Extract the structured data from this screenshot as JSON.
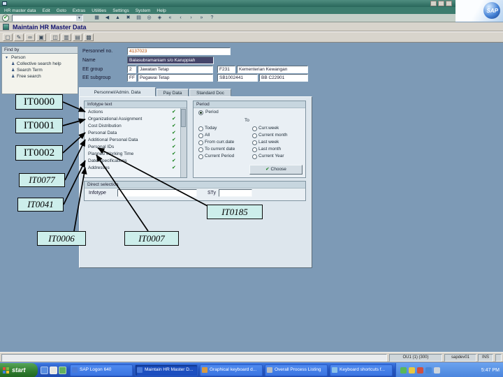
{
  "window": {
    "menu_items": [
      "HR master data",
      "Edit",
      "Goto",
      "Extras",
      "Utilities",
      "Settings",
      "System",
      "Help"
    ],
    "logo_text": "SAP",
    "screen_title": "Maintain HR Master Data"
  },
  "toolbar": {
    "command_value": "",
    "enter_glyph": "✔",
    "dropdown_glyph": "▼",
    "icons": [
      {
        "name": "save",
        "glyph": "▦"
      },
      {
        "name": "back",
        "glyph": "◀"
      },
      {
        "name": "exit",
        "glyph": "▲"
      },
      {
        "name": "cancel",
        "glyph": "✖"
      },
      {
        "name": "print",
        "glyph": "▤"
      },
      {
        "name": "find",
        "glyph": "◎"
      },
      {
        "name": "find-next",
        "glyph": "◈"
      },
      {
        "name": "first-page",
        "glyph": "«"
      },
      {
        "name": "page-up",
        "glyph": "‹"
      },
      {
        "name": "page-down",
        "glyph": "›"
      },
      {
        "name": "last-page",
        "glyph": "»"
      },
      {
        "name": "help",
        "glyph": "?"
      }
    ]
  },
  "app_toolbar": {
    "icons": [
      {
        "name": "create",
        "glyph": "▢"
      },
      {
        "name": "change",
        "glyph": "✎"
      },
      {
        "name": "display",
        "glyph": "∞"
      },
      {
        "name": "copy",
        "glyph": "▣"
      },
      {
        "name": "delimit",
        "glyph": "◫"
      },
      {
        "name": "delete",
        "glyph": "▥"
      },
      {
        "name": "overview",
        "glyph": "▤"
      },
      {
        "name": "measures",
        "glyph": "▩"
      }
    ]
  },
  "find_by": {
    "title": "Find by",
    "root_expander": "▾",
    "person_glyph": "♟",
    "root_label": "Person",
    "items": [
      "Collective search help",
      "Search Term",
      "Free search"
    ]
  },
  "form": {
    "personnel_no_label": "Personnel no.",
    "personnel_no_value": "4137023",
    "name_label": "Name",
    "name_value": "Balasubramaniam s/o Karuppiah",
    "ee_group_label": "EE group",
    "ee_group_value": "2",
    "ee_group_text": "Jawatan Tetap",
    "pers_area_value": "F231",
    "pers_area_text": "Kementerian Kewangan",
    "ee_subgroup_label": "EE subgroup",
    "ee_subgroup_value": "FF",
    "ee_subgroup_text": "Pegawai Tetap",
    "cost_center_value": "SB1002441",
    "cost_center_text": "BB C22901"
  },
  "tabs": {
    "items": [
      "Personnel/Admin. Data",
      "Pay Data",
      "Standard Doc"
    ]
  },
  "infotype_list": {
    "header": "Infotype text",
    "check_glyph": "✔",
    "rows": [
      "Actions",
      "Organizational Assignment",
      "Cost Distribution",
      "Personal Data",
      "Additional Personal Data",
      "Personal IDs",
      "Planned Working Time",
      "Date Specifications",
      "Addresses"
    ]
  },
  "period": {
    "title": "Period",
    "radio_period_label": "Period",
    "from_value": "",
    "to_label": "To",
    "to_value": "",
    "options_left": [
      "Today",
      "All",
      "From curr.date",
      "To current date",
      "Current Period"
    ],
    "options_right": [
      "Curr.week",
      "Current month",
      "Last week",
      "Last month",
      "Current Year"
    ],
    "choose_glyph": "✔",
    "choose_label": "Choose"
  },
  "direct_selection": {
    "title": "Direct selection",
    "infotype_label": "Infotype",
    "infotype_value": "",
    "sty_label": "STy",
    "sty_value": ""
  },
  "statusbar": {
    "message": "",
    "system": "OU1 (1) (300)",
    "server": "sapdev01",
    "mode": "INS"
  },
  "annotations": {
    "items": [
      "IT0000",
      "IT0001",
      "IT0002",
      "IT0077",
      "IT0041",
      "IT0185",
      "IT0006",
      "IT0007"
    ]
  },
  "taskbar": {
    "start_label": "start",
    "buttons": [
      "SAP Logon 640",
      "Maintain HR Master D...",
      "Graphical keyboard d...",
      "Overall Process Listing",
      "Keyboard shortcuts f..."
    ],
    "clock": "5:47 PM"
  }
}
